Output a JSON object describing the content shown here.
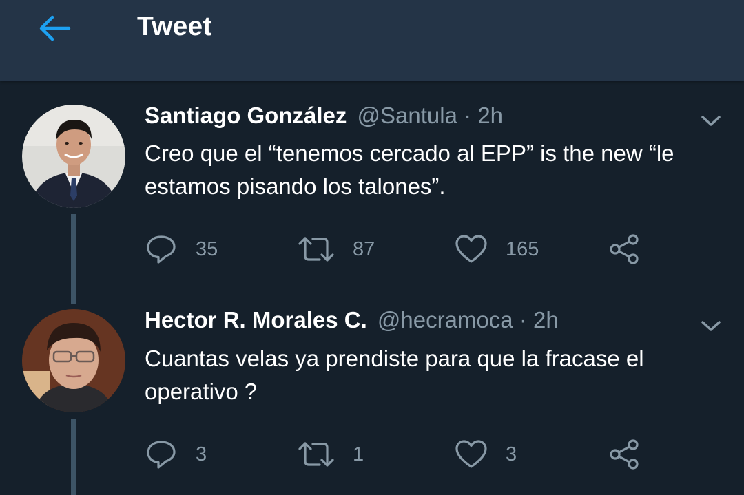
{
  "header": {
    "title": "Tweet",
    "back_icon": "arrow-left-icon"
  },
  "colors": {
    "background": "#15202b",
    "header": "#243447",
    "accent": "#1da1f2",
    "muted": "#8899a6",
    "thread_line": "#3d5466"
  },
  "tweets": [
    {
      "author": "Santiago González",
      "handle": "@Santula",
      "separator": "·",
      "time": "2h",
      "text": "Creo que el “tenemos cercado al EPP” is the new “le estamos pisando los talones”.",
      "replies": "35",
      "retweets": "87",
      "likes": "165"
    },
    {
      "author": "Hector R. Morales C.",
      "handle": "@hecramoca",
      "separator": "·",
      "time": "2h",
      "text": "Cuantas velas ya prendiste para que la fracase el operativo ?",
      "replies": "3",
      "retweets": "1",
      "likes": "3"
    }
  ]
}
